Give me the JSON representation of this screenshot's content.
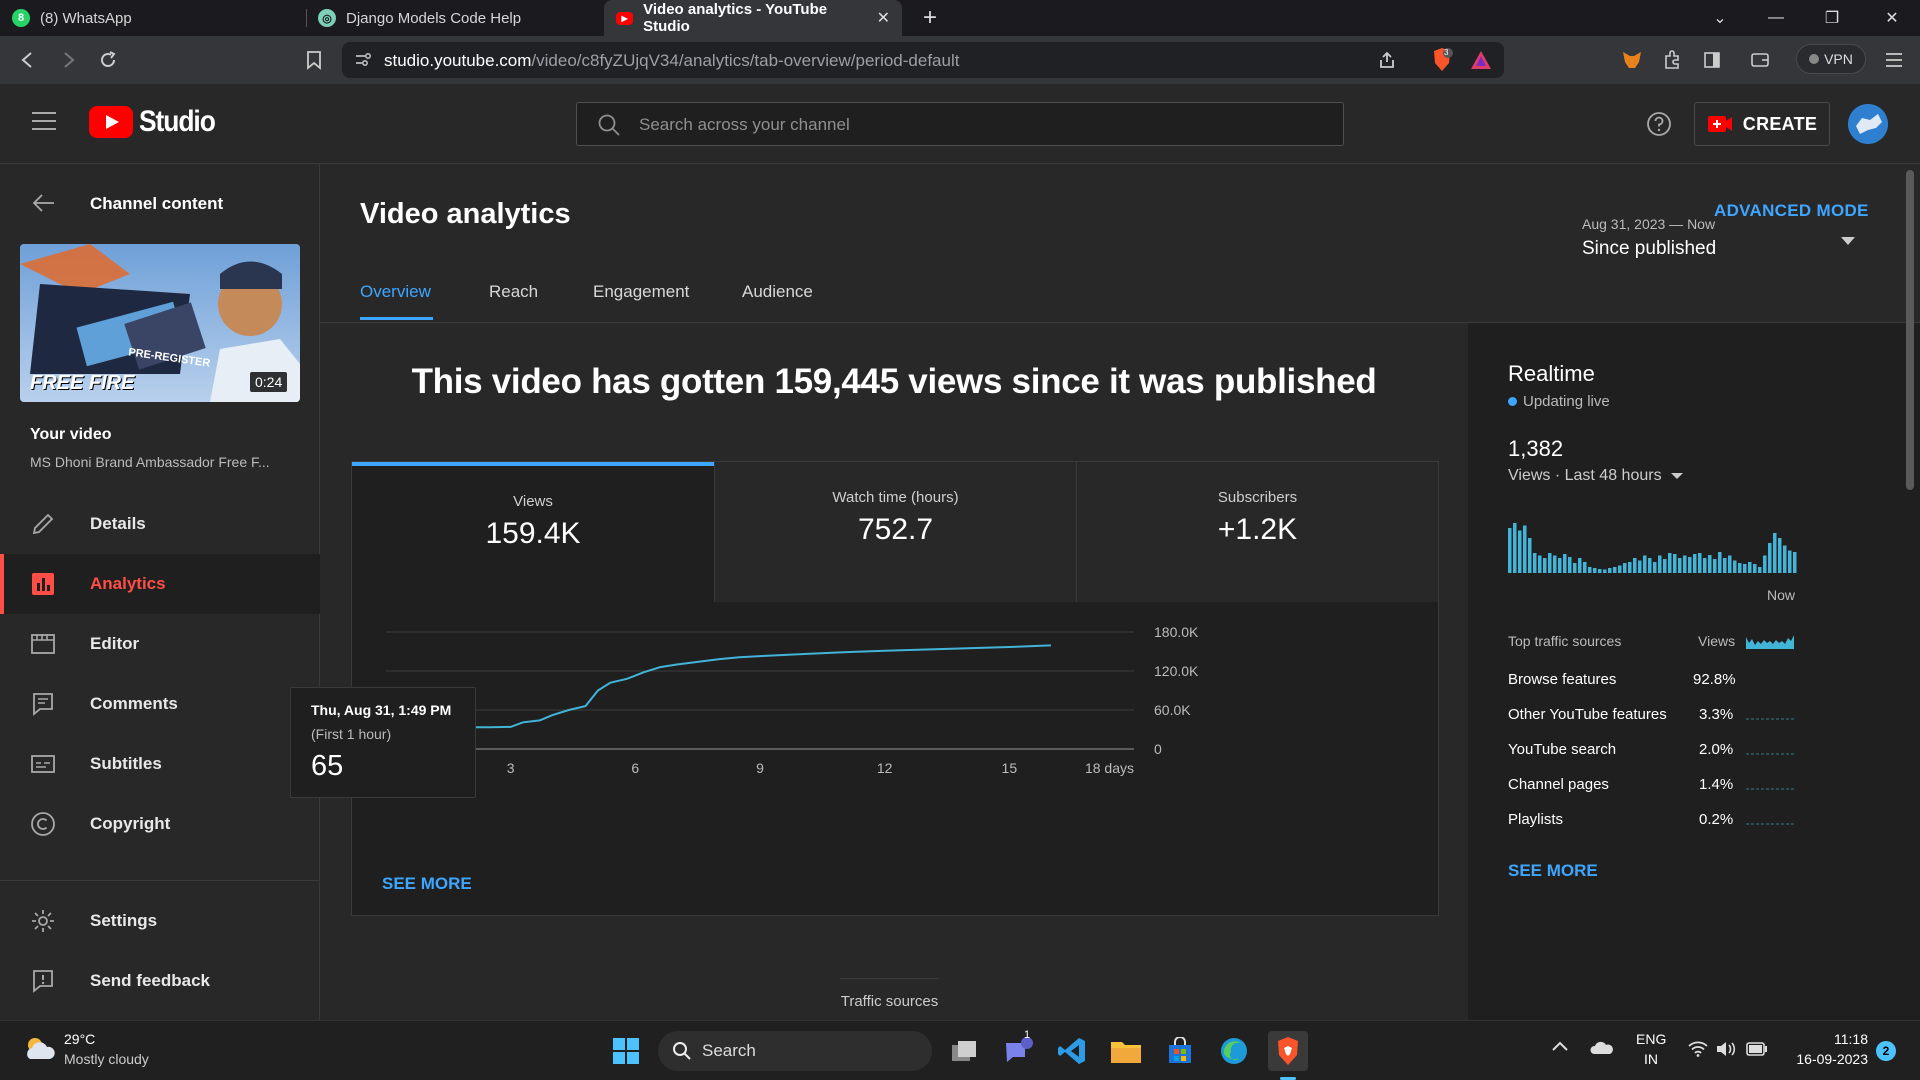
{
  "browser": {
    "tabs": [
      {
        "title": "(8) WhatsApp"
      },
      {
        "title": "Django Models Code Help"
      },
      {
        "title": "Video analytics - YouTube Studio"
      }
    ],
    "url": {
      "host": "studio.youtube.com",
      "path": "/video/c8fyZUjqV34/analytics/tab-overview/period-default"
    },
    "vpn_label": "VPN",
    "brave_badge": "3"
  },
  "header": {
    "logo_text": "Studio",
    "search_placeholder": "Search across your channel",
    "create_label": "CREATE"
  },
  "sidebar": {
    "back_label": "Channel content",
    "thumbnail_duration": "0:24",
    "thumbnail_text": "FREE FIRE",
    "thumbnail_overlay": "PRE-REGISTER",
    "your_video_label": "Your video",
    "video_title": "MS Dhoni Brand Ambassador Free F...",
    "items": [
      {
        "label": "Details",
        "icon": "pencil-icon"
      },
      {
        "label": "Analytics",
        "icon": "analytics-icon"
      },
      {
        "label": "Editor",
        "icon": "editor-icon"
      },
      {
        "label": "Comments",
        "icon": "comments-icon"
      },
      {
        "label": "Subtitles",
        "icon": "subtitles-icon"
      },
      {
        "label": "Copyright",
        "icon": "copyright-icon"
      }
    ],
    "bottom_items": [
      {
        "label": "Settings",
        "icon": "gear-icon"
      },
      {
        "label": "Send feedback",
        "icon": "feedback-icon"
      }
    ]
  },
  "main": {
    "title": "Video analytics",
    "advanced_mode": "ADVANCED MODE",
    "tabs": [
      "Overview",
      "Reach",
      "Engagement",
      "Audience"
    ],
    "date_range": "Aug 31, 2023 — Now",
    "period": "Since published",
    "headline": "This video has gotten 159,445 views since it was published",
    "metrics": [
      {
        "label": "Views",
        "value": "159.4K"
      },
      {
        "label": "Watch time (hours)",
        "value": "752.7"
      },
      {
        "label": "Subscribers",
        "value": "+1.2K"
      }
    ],
    "see_more": "SEE MORE",
    "section_next": "Traffic sources",
    "tooltip": {
      "date": "Thu, Aug 31, 1:49 PM",
      "note": "(First 1 hour)",
      "value": "65"
    }
  },
  "chart_data": {
    "type": "line",
    "x_tick_labels": [
      "0",
      "3",
      "6",
      "9",
      "12",
      "15",
      "18 days"
    ],
    "y_tick_labels": [
      "0",
      "60.0K",
      "120.0K",
      "180.0K"
    ],
    "xlim": [
      0,
      18
    ],
    "ylim": [
      0,
      180000
    ],
    "series": [
      {
        "x": [
          0,
          0.05,
          0.5,
          1,
          1.5,
          2,
          2.5,
          3,
          3.3,
          3.7,
          4,
          4.4,
          4.8,
          5.1,
          5.4,
          5.8,
          6.2,
          6.6,
          7,
          7.5,
          8,
          8.5,
          9,
          10,
          11,
          12,
          13,
          14,
          15,
          16
        ],
        "y": [
          0,
          65,
          25000,
          33000,
          33500,
          33500,
          33500,
          34000,
          41000,
          44000,
          52000,
          60000,
          66000,
          90000,
          102000,
          108000,
          118000,
          126000,
          130000,
          134000,
          138000,
          141000,
          143000,
          146000,
          149000,
          151000,
          153000,
          155000,
          157000,
          159445
        ]
      }
    ],
    "tooltip_point": {
      "x": 0,
      "y": 65
    },
    "color": "#41b4d8"
  },
  "realtime": {
    "title": "Realtime",
    "status": "Updating live",
    "count": "1,382",
    "subtitle": "Views · Last 48 hours",
    "now_label": "Now",
    "bars": [
      0.9,
      1.0,
      0.85,
      0.95,
      0.7,
      0.4,
      0.35,
      0.3,
      0.4,
      0.35,
      0.3,
      0.38,
      0.32,
      0.2,
      0.3,
      0.22,
      0.12,
      0.1,
      0.08,
      0.07,
      0.1,
      0.12,
      0.15,
      0.2,
      0.22,
      0.3,
      0.25,
      0.35,
      0.3,
      0.22,
      0.35,
      0.28,
      0.4,
      0.38,
      0.3,
      0.35,
      0.32,
      0.38,
      0.4,
      0.3,
      0.36,
      0.28,
      0.42,
      0.3,
      0.35,
      0.25,
      0.2,
      0.18,
      0.22,
      0.18,
      0.12,
      0.35,
      0.6,
      0.8,
      0.7,
      0.55,
      0.45,
      0.42
    ],
    "traffic_header_left": "Top traffic sources",
    "traffic_header_right": "Views",
    "sources": [
      {
        "name": "Browse features",
        "value": "92.8%"
      },
      {
        "name": "Other YouTube features",
        "value": "3.3%"
      },
      {
        "name": "YouTube search",
        "value": "2.0%"
      },
      {
        "name": "Channel pages",
        "value": "1.4%"
      },
      {
        "name": "Playlists",
        "value": "0.2%"
      }
    ],
    "see_more": "SEE MORE"
  },
  "taskbar": {
    "weather_temp": "29°C",
    "weather_desc": "Mostly cloudy",
    "search_label": "Search",
    "lang_top": "ENG",
    "lang_bottom": "IN",
    "time": "11:18",
    "date": "16-09-2023",
    "notif_count": "2",
    "teams_badge": "1"
  },
  "colors": {
    "accent_blue": "#3ea6ff",
    "yt_red": "#ff0000",
    "active_red": "#ff4e45",
    "chart_line": "#41b4d8"
  }
}
